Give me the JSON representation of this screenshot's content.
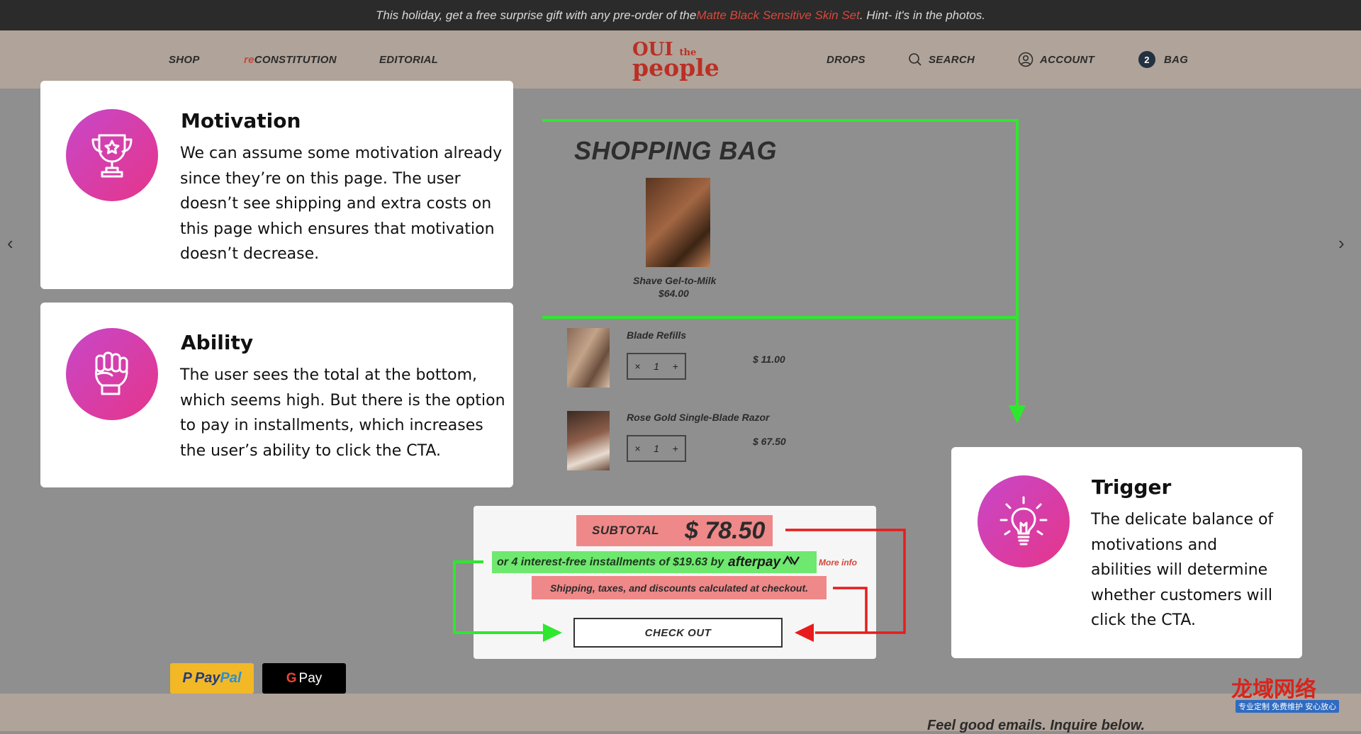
{
  "announcement": {
    "pre": "This holiday, get a free surprise gift with any pre-order of the ",
    "highlight": "Matte Black Sensitive Skin Set",
    "post": ". Hint- it's in the photos."
  },
  "nav": {
    "shop": "SHOP",
    "re_prefix": "re",
    "reconstitution": "CONSTITUTION",
    "editorial": "EDITORIAL",
    "drops": "DROPS",
    "search": "SEARCH",
    "account": "ACCOUNT",
    "bag_count": "2",
    "bag": "BAG"
  },
  "logo": {
    "line1": "OUI",
    "the": "the",
    "line2": "people"
  },
  "bag": {
    "title": "SHOPPING BAG",
    "featured": {
      "name": "Shave Gel-to-Milk",
      "price": "$64.00"
    },
    "items": [
      {
        "name": "Blade Refills",
        "qty": "1",
        "price": "$ 11.00",
        "minus": "×",
        "plus": "+"
      },
      {
        "name": "Rose Gold Single-Blade Razor",
        "qty": "1",
        "price": "$ 67.50",
        "minus": "×",
        "plus": "+"
      }
    ]
  },
  "summary": {
    "subtotal_label": "SUBTOTAL",
    "subtotal_amount": "$ 78.50",
    "afterpay_text": "or 4 interest-free installments of $19.63 by",
    "afterpay_brand": "afterpay",
    "more_info": "More info",
    "shipping_note": "Shipping, taxes, and discounts calculated at checkout.",
    "checkout": "CHECK OUT"
  },
  "payments": {
    "paypal_a": "Pay",
    "paypal_b": "Pal",
    "gpay_g": "G",
    "gpay": "Pay"
  },
  "footer": {
    "text": "Feel good emails. Inquire below."
  },
  "cards": {
    "motivation": {
      "title": "Motivation",
      "lines": [
        "We can assume some motivation already",
        "since they’re on this page. The user",
        "doesn’t see shipping and extra costs on",
        "this page which ensures that motivation",
        "doesn’t decrease."
      ]
    },
    "ability": {
      "title": "Ability",
      "lines": [
        "The user sees the total at the bottom,",
        "which seems high. But there is the option",
        "to pay in installments, which increases",
        "the user’s ability to click the CTA."
      ]
    },
    "trigger": {
      "title": "Trigger",
      "lines": [
        "The delicate balance of",
        "motivations and",
        "abilities will determine",
        "whether customers will",
        "click the CTA."
      ]
    }
  },
  "watermark": {
    "title": "龙域网络",
    "subtitle": "专业定制 免费维护 安心放心"
  },
  "colors": {
    "accent_gradient_start": "#c747c9",
    "accent_gradient_end": "#e6358a",
    "green_arrow": "#2ee82e",
    "red_arrow": "#e81c1c",
    "brand_red": "#bb2f25"
  },
  "icons": {
    "prev": "chevron-left-icon",
    "next": "chevron-right-icon",
    "search": "search-icon",
    "account": "account-icon",
    "motivation": "trophy-icon",
    "ability": "fist-icon",
    "trigger": "lightbulb-icon"
  }
}
